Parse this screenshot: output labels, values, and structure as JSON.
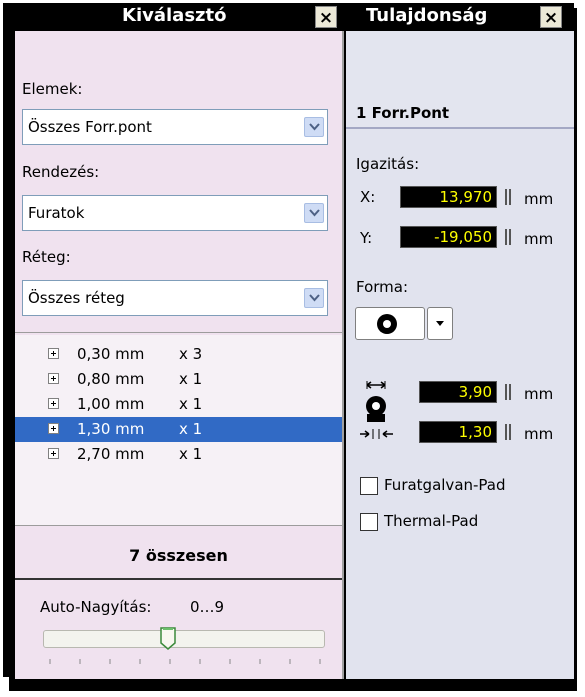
{
  "left_panel": {
    "title": "Kiválasztó",
    "close": "×",
    "elemek_label": "Elemek:",
    "elemek_value": "Összes Forr.pont",
    "rendezes_label": "Rendezés:",
    "rendezes_value": "Furatok",
    "reteg_label": "Réteg:",
    "reteg_value": "Összes réteg",
    "items": [
      {
        "size": "0,30 mm",
        "count": "x 3",
        "selected": false
      },
      {
        "size": "0,80 mm",
        "count": "x 1",
        "selected": false
      },
      {
        "size": "1,00 mm",
        "count": "x 1",
        "selected": false
      },
      {
        "size": "1,30 mm",
        "count": "x 1",
        "selected": true
      },
      {
        "size": "2,70 mm",
        "count": "x 1",
        "selected": false
      }
    ],
    "total": "7 összesen",
    "auto_zoom_label": "Auto-Nagyítás:",
    "auto_zoom_range": "0…9",
    "slider_value": 3
  },
  "right_panel": {
    "title": "Tulajdonság",
    "close": "×",
    "header": "1 Forr.Pont",
    "igazitas_label": "Igazitás:",
    "x_label": "X:",
    "x_value": "13,970",
    "y_label": "Y:",
    "y_value": "-19,050",
    "unit": "mm",
    "forma_label": "Forma:",
    "outer_value": "3,90",
    "inner_value": "1,30",
    "furatgalvan_label": "Furatgalvan-Pad",
    "thermal_label": "Thermal-Pad"
  },
  "colors": {
    "field_bg": "#000000",
    "field_text": "#ffff00",
    "selection": "#316ac5",
    "left_bg": "#f0e2ef",
    "right_bg": "#e1e3ee"
  }
}
